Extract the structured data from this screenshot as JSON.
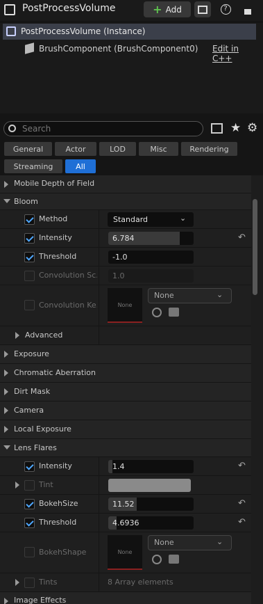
{
  "header": {
    "title": "PostProcessVolume",
    "add_label": "Add"
  },
  "tree": {
    "root": "PostProcessVolume (Instance)",
    "child": "BrushComponent (BrushComponent0)",
    "edit_link": "Edit in C++"
  },
  "search": {
    "placeholder": "Search"
  },
  "filters": [
    "General",
    "Actor",
    "LOD",
    "Misc",
    "Rendering",
    "Streaming",
    "All"
  ],
  "active_filter": "All",
  "accent": "#1f6fd6",
  "props": {
    "mobile_dof": "Mobile Depth of Field",
    "bloom": "Bloom",
    "method": "Method",
    "method_value": "Standard",
    "intensity": "Intensity",
    "intensity_value": "6.784",
    "threshold": "Threshold",
    "threshold_value": "-1.0",
    "conv_scale": "Convolution Sc...",
    "conv_scale_value": "1.0",
    "conv_kernel": "Convolution Ke...",
    "conv_kernel_tex": "None",
    "conv_kernel_combo": "None",
    "advanced": "Advanced",
    "exposure": "Exposure",
    "chromatic": "Chromatic Aberration",
    "dirt": "Dirt Mask",
    "camera": "Camera",
    "local_exposure": "Local Exposure",
    "lens_flares": "Lens Flares",
    "lf_intensity": "Intensity",
    "lf_intensity_value": "1.4",
    "tint": "Tint",
    "bokeh_size": "BokehSize",
    "bokeh_size_value": "11.52",
    "lf_threshold": "Threshold",
    "lf_threshold_value": "4.6936",
    "bokeh_shape": "BokehShape",
    "bokeh_shape_tex": "None",
    "bokeh_shape_combo": "None",
    "tints": "Tints",
    "tints_value": "8 Array elements",
    "image_effects": "Image Effects"
  }
}
